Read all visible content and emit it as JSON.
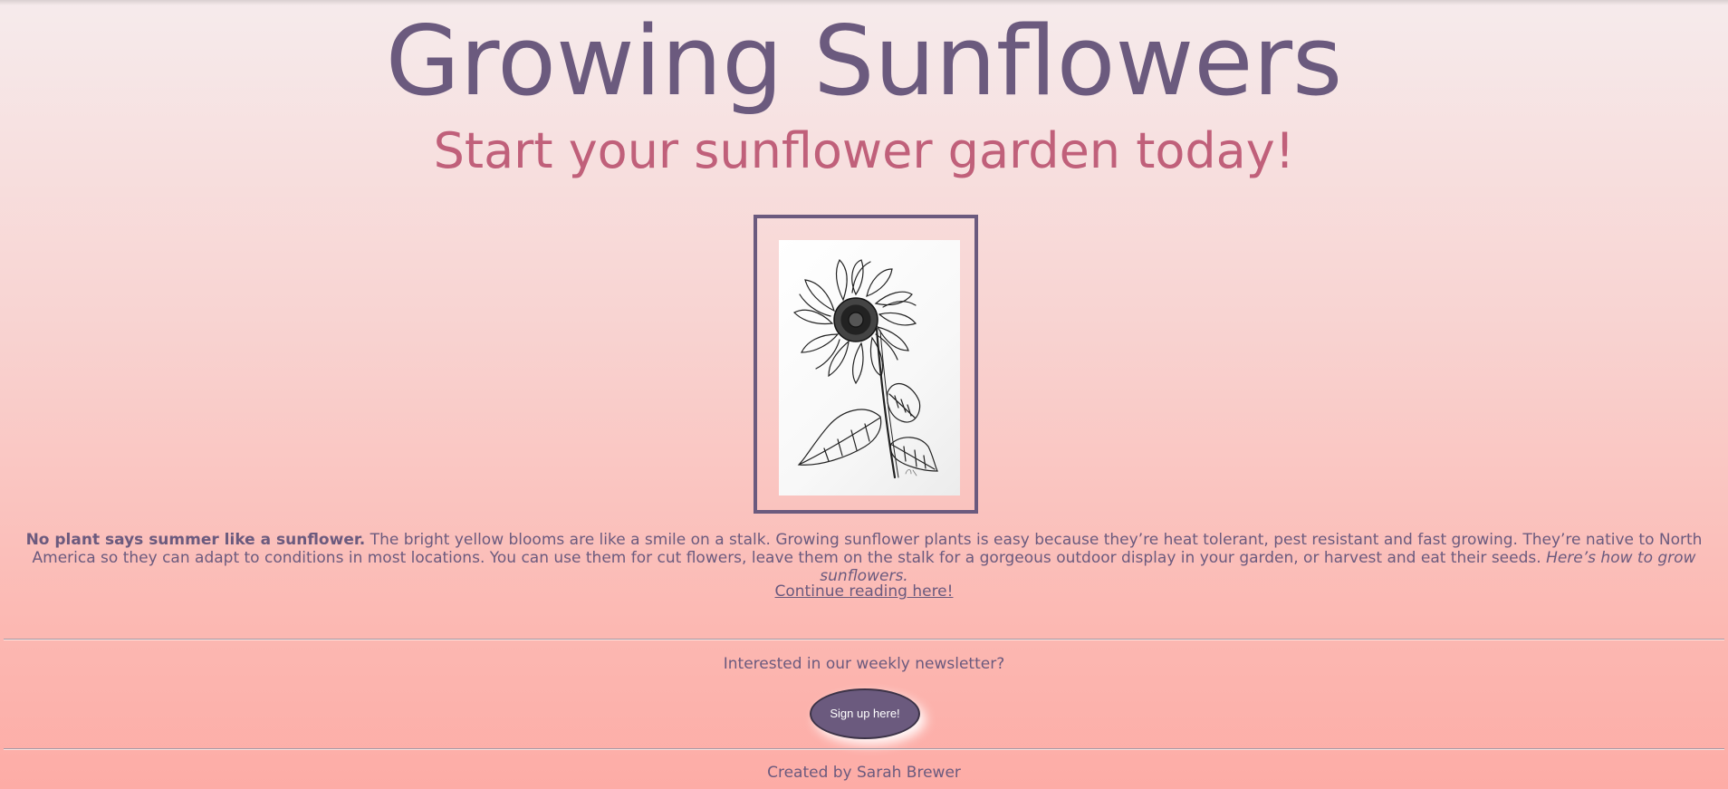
{
  "header": {
    "title": "Growing Sunflowers",
    "subtitle": "Start your sunflower garden today!"
  },
  "image": {
    "icon": "sunflower-drawing"
  },
  "intro": {
    "lead": "No plant says summer like a sunflower.",
    "body": " The bright yellow blooms are like a smile on a stalk. Growing sunflower plants is easy because they’re heat tolerant, pest resistant and fast growing. They’re native to North America so they can adapt to conditions in most locations. You can use them for cut flowers, leave them on the stalk for a gorgeous outdoor display in your garden, or harvest and eat their seeds. ",
    "closing": "Here’s how to grow sunflowers."
  },
  "continue_link": "Continue reading here!",
  "newsletter": {
    "prompt": "Interested in our weekly newsletter?",
    "button_label": "Sign up here!"
  },
  "footer": {
    "credit": "Created by Sarah Brewer"
  },
  "colors": {
    "primary": "#6b5a7e",
    "accent": "#c0607a",
    "background_top": "#f6ebec",
    "background_bottom": "#fdaca6"
  }
}
